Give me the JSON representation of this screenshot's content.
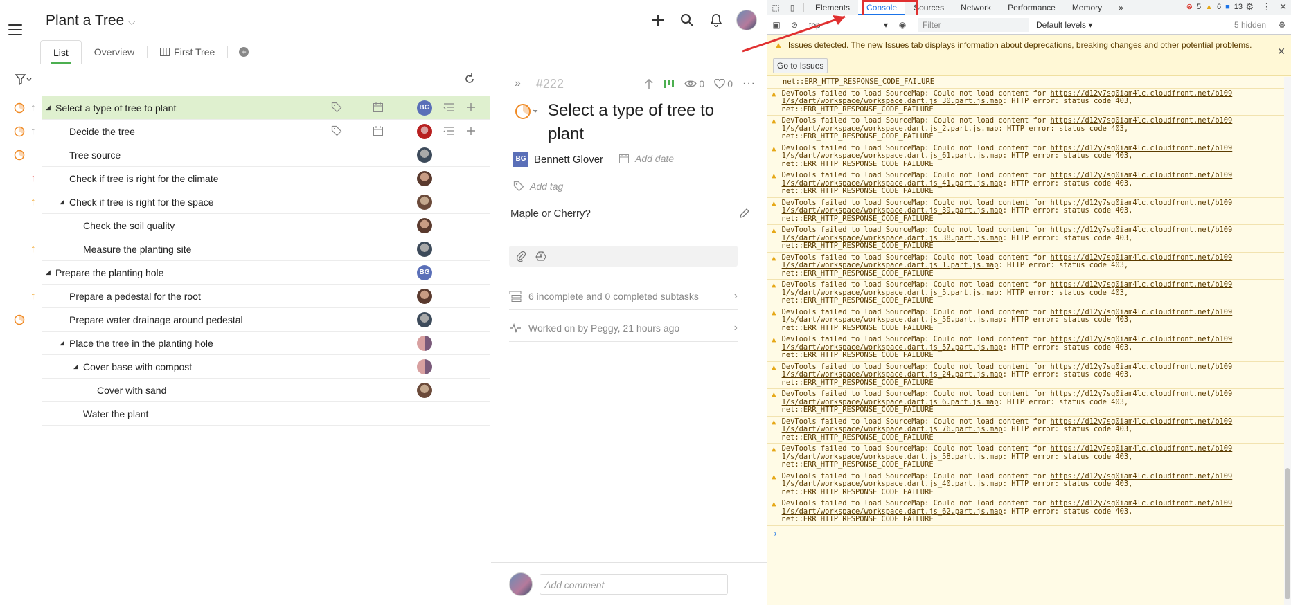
{
  "project": {
    "title": "Plant a Tree"
  },
  "tabs": [
    {
      "label": "List",
      "active": true
    },
    {
      "label": "Overview",
      "active": false
    },
    {
      "label": "First Tree",
      "active": false
    }
  ],
  "tasks": [
    {
      "name": "Select a type of tree to plant",
      "indent": 0,
      "expand": true,
      "mark": "progress",
      "prio": "up-gray",
      "assignee": "BG",
      "av": "bg",
      "selected": true,
      "hover_icons": true
    },
    {
      "name": "Decide the tree",
      "indent": 1,
      "expand": false,
      "mark": "progress",
      "prio": "up-gray",
      "assignee": "",
      "av": "p2",
      "selected": false,
      "hover_icons": true
    },
    {
      "name": "Tree source",
      "indent": 1,
      "expand": false,
      "mark": "progress",
      "prio": "",
      "assignee": "",
      "av": "p3",
      "selected": false
    },
    {
      "name": "Check if tree is right for the climate",
      "indent": 1,
      "expand": false,
      "mark": "",
      "prio": "up-red",
      "assignee": "",
      "av": "p1",
      "selected": false
    },
    {
      "name": "Check if tree is right for the space",
      "indent": 1,
      "expand": true,
      "mark": "",
      "prio": "up-orange",
      "assignee": "",
      "av": "p4",
      "selected": false
    },
    {
      "name": "Check the soil quality",
      "indent": 2,
      "expand": false,
      "mark": "",
      "prio": "",
      "assignee": "",
      "av": "p1",
      "selected": false
    },
    {
      "name": "Measure the planting site",
      "indent": 2,
      "expand": false,
      "mark": "",
      "prio": "up-orange",
      "assignee": "",
      "av": "p3",
      "selected": false
    },
    {
      "name": "Prepare the planting hole",
      "indent": 0,
      "expand": true,
      "mark": "",
      "prio": "",
      "assignee": "BG",
      "av": "bg",
      "selected": false
    },
    {
      "name": "Prepare a pedestal for the root",
      "indent": 1,
      "expand": false,
      "mark": "",
      "prio": "up-orange",
      "assignee": "",
      "av": "p1",
      "selected": false
    },
    {
      "name": "Prepare water drainage around pedestal",
      "indent": 1,
      "expand": false,
      "mark": "progress",
      "prio": "",
      "assignee": "",
      "av": "p3",
      "selected": false
    },
    {
      "name": "Place the tree in the planting hole",
      "indent": 1,
      "expand": true,
      "mark": "",
      "prio": "",
      "assignee": "",
      "av": "p5",
      "selected": false
    },
    {
      "name": "Cover base with compost",
      "indent": 2,
      "expand": true,
      "mark": "",
      "prio": "",
      "assignee": "",
      "av": "p5",
      "selected": false
    },
    {
      "name": "Cover with sand",
      "indent": 3,
      "expand": false,
      "mark": "",
      "prio": "",
      "assignee": "",
      "av": "p4",
      "selected": false
    },
    {
      "name": "Water the plant",
      "indent": 2,
      "expand": false,
      "mark": "",
      "prio": "",
      "assignee": "",
      "av": "",
      "selected": false
    }
  ],
  "detail": {
    "number": "#222",
    "views": "0",
    "likes": "0",
    "title": "Select a type of tree to plant",
    "assignee_initials": "BG",
    "assignee_name": "Bennett Glover",
    "date_placeholder": "Add date",
    "tag_placeholder": "Add tag",
    "description": "Maple or Cherry?",
    "subtasks": "6 incomplete and 0 completed subtasks",
    "activity": "Worked on by Peggy, 21 hours ago",
    "comment_placeholder": "Add comment"
  },
  "devtools": {
    "tabs": [
      "Elements",
      "Console",
      "Sources",
      "Network",
      "Performance",
      "Memory"
    ],
    "active_tab": "Console",
    "more": "»",
    "errors": "5",
    "warnings": "6",
    "infos": "13",
    "context": "top",
    "filter_placeholder": "Filter",
    "levels": "Default levels ▾",
    "hidden": "5 hidden",
    "issues_msg": "Issues detected. The new Issues tab displays information about deprecations, breaking changes and other potential problems.",
    "go_issues": "Go to Issues",
    "first_log_tail": "net::ERR_HTTP_RESPONSE_CODE_FAILURE",
    "log_prefix": "DevTools failed to load SourceMap: Could not load content for ",
    "log_url_a": "https://d12y7sg0iam4lc.cloudfront.net/b109",
    "log_url_b_prefix": "1/s/dart/workspace/workspace.dart.js_",
    "log_url_b_suffix": ".part.js.map",
    "log_suffix": ": HTTP error: status code 403,",
    "log_tail": "net::ERR_HTTP_RESPONSE_CODE_FAILURE",
    "log_parts": [
      "30",
      "2",
      "61",
      "41",
      "39",
      "38",
      "1",
      "5",
      "56",
      "57",
      "24",
      "6",
      "76",
      "58",
      "40",
      "62"
    ]
  }
}
